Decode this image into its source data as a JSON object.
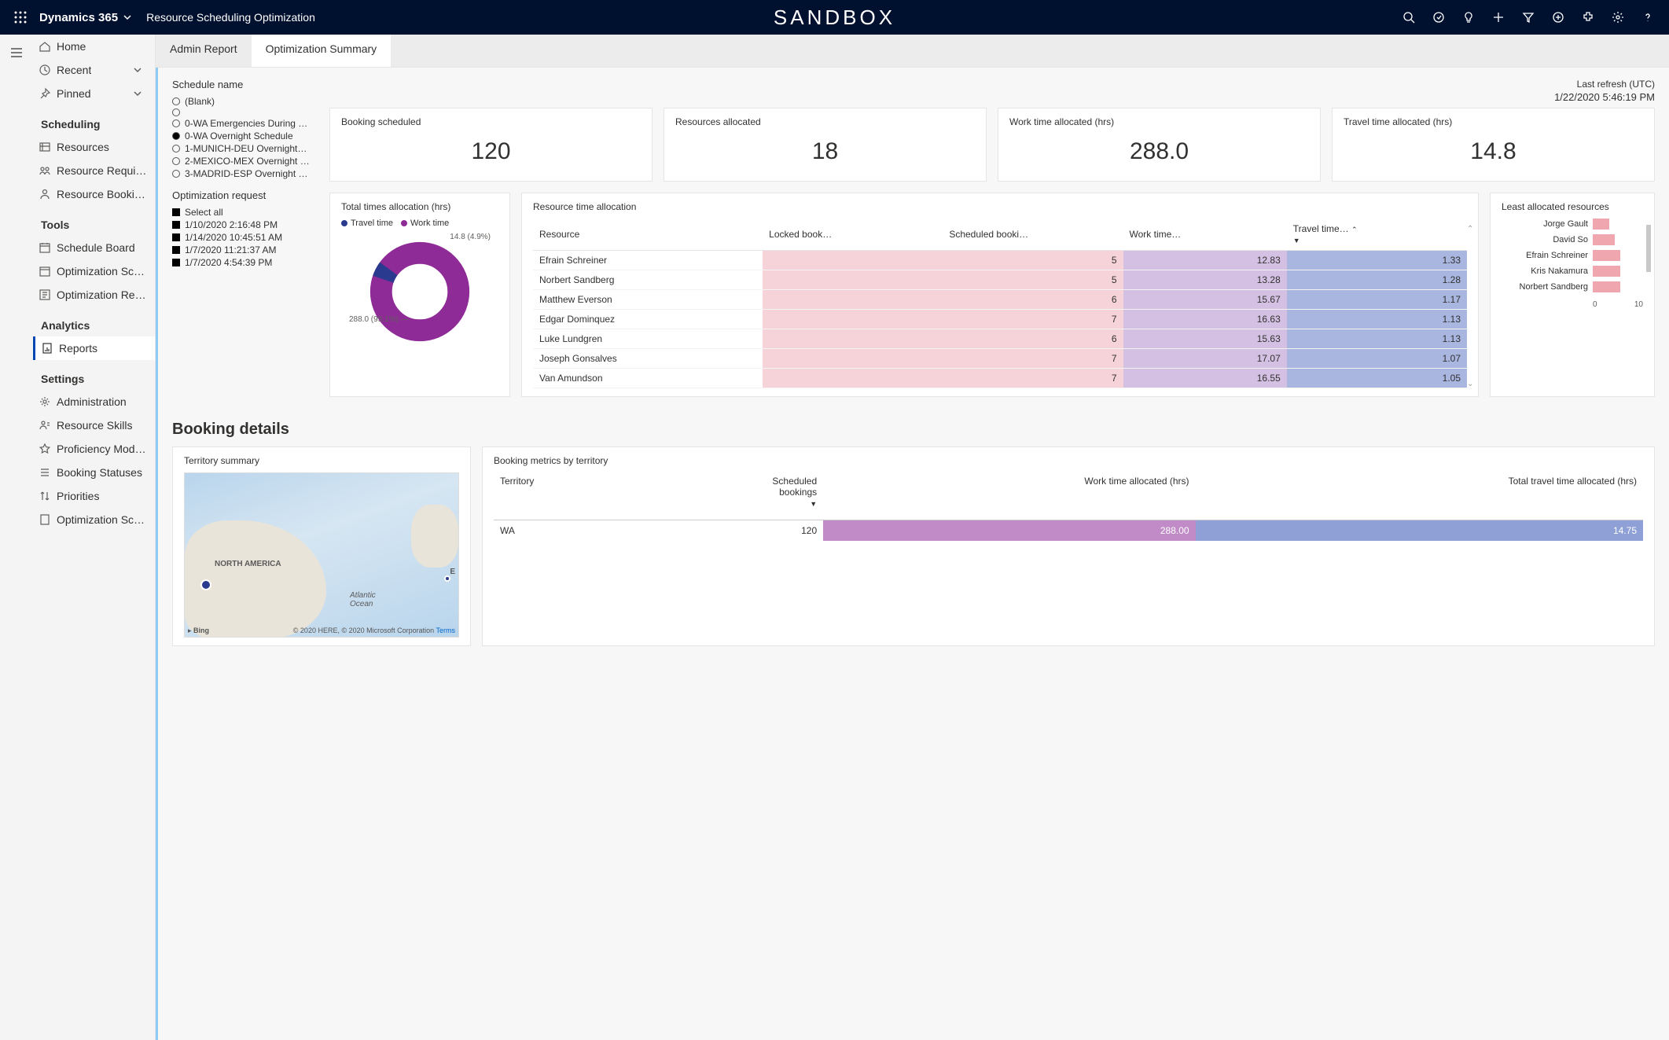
{
  "topnav": {
    "brand": "Dynamics 365",
    "app": "Resource Scheduling Optimization",
    "sandbox": "SANDBOX"
  },
  "sidenav": {
    "home": "Home",
    "recent": "Recent",
    "pinned": "Pinned",
    "groups": {
      "scheduling": "Scheduling",
      "tools": "Tools",
      "analytics": "Analytics",
      "settings": "Settings"
    },
    "items": {
      "resources": "Resources",
      "resource_req": "Resource Require…",
      "resource_bookings": "Resource Bookings",
      "schedule_board": "Schedule Board",
      "opt_sched": "Optimization Sche…",
      "opt_req": "Optimization Req…",
      "reports": "Reports",
      "administration": "Administration",
      "resource_skills": "Resource Skills",
      "proficiency": "Proficiency Models",
      "booking_status": "Booking Statuses",
      "priorities": "Priorities",
      "opt_sco": "Optimization Sco…"
    }
  },
  "tabs": {
    "admin": "Admin Report",
    "summary": "Optimization Summary"
  },
  "filters": {
    "schedule_title": "Schedule name",
    "schedules": [
      {
        "label": "(Blank)",
        "sel": false
      },
      {
        "label": "",
        "sel": false
      },
      {
        "label": "0-WA Emergencies During …",
        "sel": false
      },
      {
        "label": "0-WA Overnight Schedule",
        "sel": true
      },
      {
        "label": "1-MUNICH-DEU Overnight…",
        "sel": false
      },
      {
        "label": "2-MEXICO-MEX Overnight …",
        "sel": false
      },
      {
        "label": "3-MADRID-ESP Overnight …",
        "sel": false
      }
    ],
    "optreq_title": "Optimization request",
    "optreqs": [
      {
        "label": "Select all",
        "all": true
      },
      {
        "label": "1/10/2020 2:16:48 PM"
      },
      {
        "label": "1/14/2020 10:45:51 AM"
      },
      {
        "label": "1/7/2020 11:21:37 AM"
      },
      {
        "label": "1/7/2020 4:54:39 PM"
      }
    ]
  },
  "refresh": {
    "label": "Last refresh (UTC)",
    "value": "1/22/2020 5:46:19 PM"
  },
  "kpis": {
    "booking_label": "Booking scheduled",
    "booking_value": "120",
    "resources_label": "Resources allocated",
    "resources_value": "18",
    "work_label": "Work time allocated (hrs)",
    "work_value": "288.0",
    "travel_label": "Travel time allocated (hrs)",
    "travel_value": "14.8"
  },
  "chart_data": {
    "donut": {
      "type": "pie",
      "title": "Total times allocation (hrs)",
      "series": [
        {
          "name": "Travel time",
          "value": 14.8,
          "pct": "4.9%",
          "color": "#2a3b8f"
        },
        {
          "name": "Work time",
          "value": 288.0,
          "pct": "95.1%",
          "color": "#8e2b97"
        }
      ],
      "labels": {
        "top": "14.8 (4.9%)",
        "bot": "288.0 (95.1%)"
      }
    },
    "resource_table": {
      "title": "Resource time allocation",
      "columns": [
        "Resource",
        "Locked book…",
        "Scheduled booki…",
        "Work time…",
        "Travel time…"
      ],
      "rows": [
        {
          "name": "Efrain Schreiner",
          "locked": "",
          "scheduled": 5,
          "work": 12.83,
          "travel": 1.33
        },
        {
          "name": "Norbert Sandberg",
          "locked": "",
          "scheduled": 5,
          "work": 13.28,
          "travel": 1.28
        },
        {
          "name": "Matthew Everson",
          "locked": "",
          "scheduled": 6,
          "work": 15.67,
          "travel": 1.17
        },
        {
          "name": "Edgar Dominquez",
          "locked": "",
          "scheduled": 7,
          "work": 16.63,
          "travel": 1.13
        },
        {
          "name": "Luke Lundgren",
          "locked": "",
          "scheduled": 6,
          "work": 15.63,
          "travel": 1.13
        },
        {
          "name": "Joseph Gonsalves",
          "locked": "",
          "scheduled": 7,
          "work": 17.07,
          "travel": 1.07
        },
        {
          "name": "Van Amundson",
          "locked": "",
          "scheduled": 7,
          "work": 16.55,
          "travel": 1.05
        }
      ]
    },
    "least_bar": {
      "type": "bar",
      "title": "Least allocated resources",
      "categories": [
        "Jorge Gault",
        "David So",
        "Efrain Schreiner",
        "Kris Nakamura",
        "Norbert Sandberg"
      ],
      "values": [
        3,
        4,
        5,
        5,
        5
      ],
      "xlim": [
        0,
        10
      ],
      "axis": [
        "0",
        "10"
      ]
    }
  },
  "booking": {
    "section": "Booking details",
    "territory_title": "Territory summary",
    "map": {
      "na": "NORTH AMERICA",
      "eu": "E",
      "ocean": "Atlantic\nOcean",
      "bing": "Bing",
      "copyright": "© 2020 HERE, © 2020 Microsoft Corporation",
      "terms": "Terms"
    },
    "metrics_title": "Booking metrics by territory",
    "metrics_cols": [
      "Territory",
      "Scheduled bookings",
      "Work time allocated (hrs)",
      "Total travel time allocated (hrs)"
    ],
    "metrics_rows": [
      {
        "territory": "WA",
        "scheduled": 120,
        "work": "288.00",
        "travel": "14.75"
      }
    ]
  }
}
